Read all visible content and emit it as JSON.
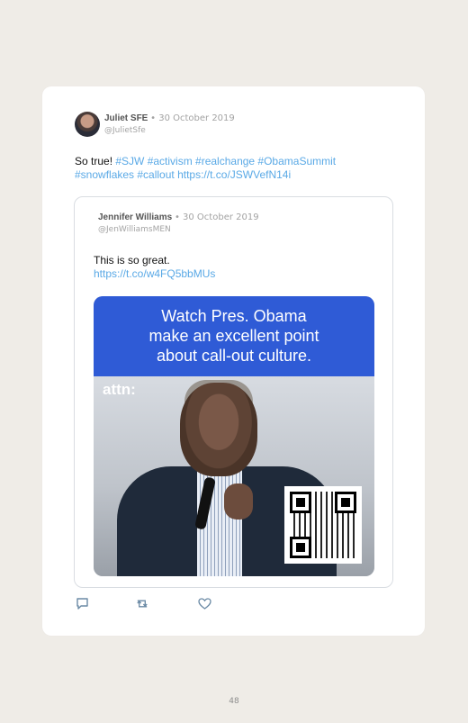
{
  "tweet": {
    "author_name": "Juliet SFE",
    "date": "• 30 October 2019",
    "handle": "@JulietSfe",
    "text_lead": "So true! ",
    "hashtags": "#SJW #activism #realchange #ObamaSummit #snowflakes #callout",
    "link": "https://t.co/JSWVefN14i"
  },
  "quoted_tweet": {
    "author_name": "Jennifer Williams",
    "date": "• 30 October 2019",
    "handle": "@JenWilliamsMEN",
    "text": "This is so great.",
    "link": "https://t.co/w4FQ5bbMUs",
    "media": {
      "banner_line1": "Watch Pres. Obama",
      "banner_line2": "make an excellent point",
      "banner_line3": "about call-out culture.",
      "logo": "attn:"
    }
  },
  "actions": {
    "reply_icon": "reply-icon",
    "retweet_icon": "retweet-icon",
    "like_icon": "heart-icon"
  },
  "page": {
    "number": "48"
  },
  "colors": {
    "background": "#efece7",
    "link": "#5aa9e6",
    "banner": "#2f5bd6"
  }
}
